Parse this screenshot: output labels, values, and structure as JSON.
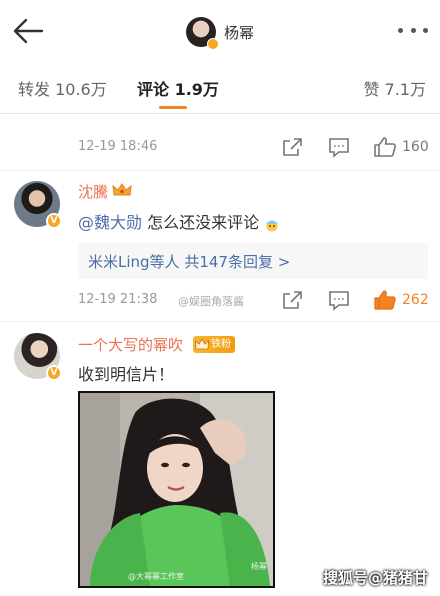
{
  "header": {
    "title": "杨幂",
    "back_icon": "back-arrow-icon",
    "more_icon": "more-dots-icon"
  },
  "tabs": [
    {
      "label": "转发 10.6万"
    },
    {
      "label": "评论 1.9万",
      "active": true
    },
    {
      "label": "赞 7.1万"
    }
  ],
  "accent_color": "#f58220",
  "link_color": "#4a6fa5",
  "username_color": "#eb7350",
  "prev_comment": {
    "time": "12-19 18:46",
    "likes": "160"
  },
  "comments": [
    {
      "username": "沈騰",
      "mention": "@魏大勋",
      "text": " 怎么还没来评论",
      "replies_link": "米米Ling等人 共147条回复 >",
      "time": "12-19 21:38",
      "likes": "262",
      "watermark": "@娱圈角落酱"
    },
    {
      "username": "一个大写的幂吹",
      "fan_badge": "铁粉",
      "text": "收到明信片！",
      "photo_watermark_left": "@大幂幂工作室",
      "photo_watermark_right": "杨幂"
    }
  ],
  "page_watermark": "搜狐号@猪猪甘"
}
